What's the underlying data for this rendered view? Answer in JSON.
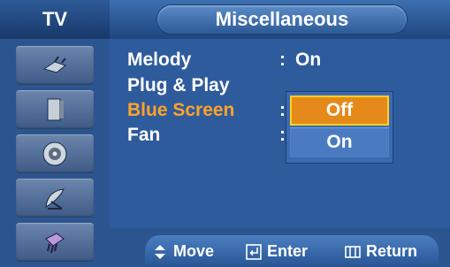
{
  "header": {
    "tab_label": "TV",
    "title": "Miscellaneous"
  },
  "sidebar": {
    "items": [
      {
        "icon": "antenna-plug-icon"
      },
      {
        "icon": "speaker-icon"
      },
      {
        "icon": "disc-speaker-icon"
      },
      {
        "icon": "satellite-dish-icon"
      },
      {
        "icon": "connector-icon"
      }
    ]
  },
  "menu": {
    "rows": [
      {
        "label": "Melody",
        "colon": ":",
        "value": "On"
      },
      {
        "label": "Plug & Play",
        "colon": "",
        "value": ""
      },
      {
        "label": "Blue Screen",
        "colon": ":",
        "value": ""
      },
      {
        "label": "Fan",
        "colon": ":",
        "value": ""
      }
    ],
    "dropdown": {
      "options": [
        "Off",
        "On"
      ],
      "selected": "Off"
    }
  },
  "footer": {
    "move": "Move",
    "enter": "Enter",
    "return": "Return"
  },
  "colors": {
    "highlight_text": "#ffa328",
    "selected_option": "#e58a1a",
    "selected_border": "#ffd21f"
  }
}
